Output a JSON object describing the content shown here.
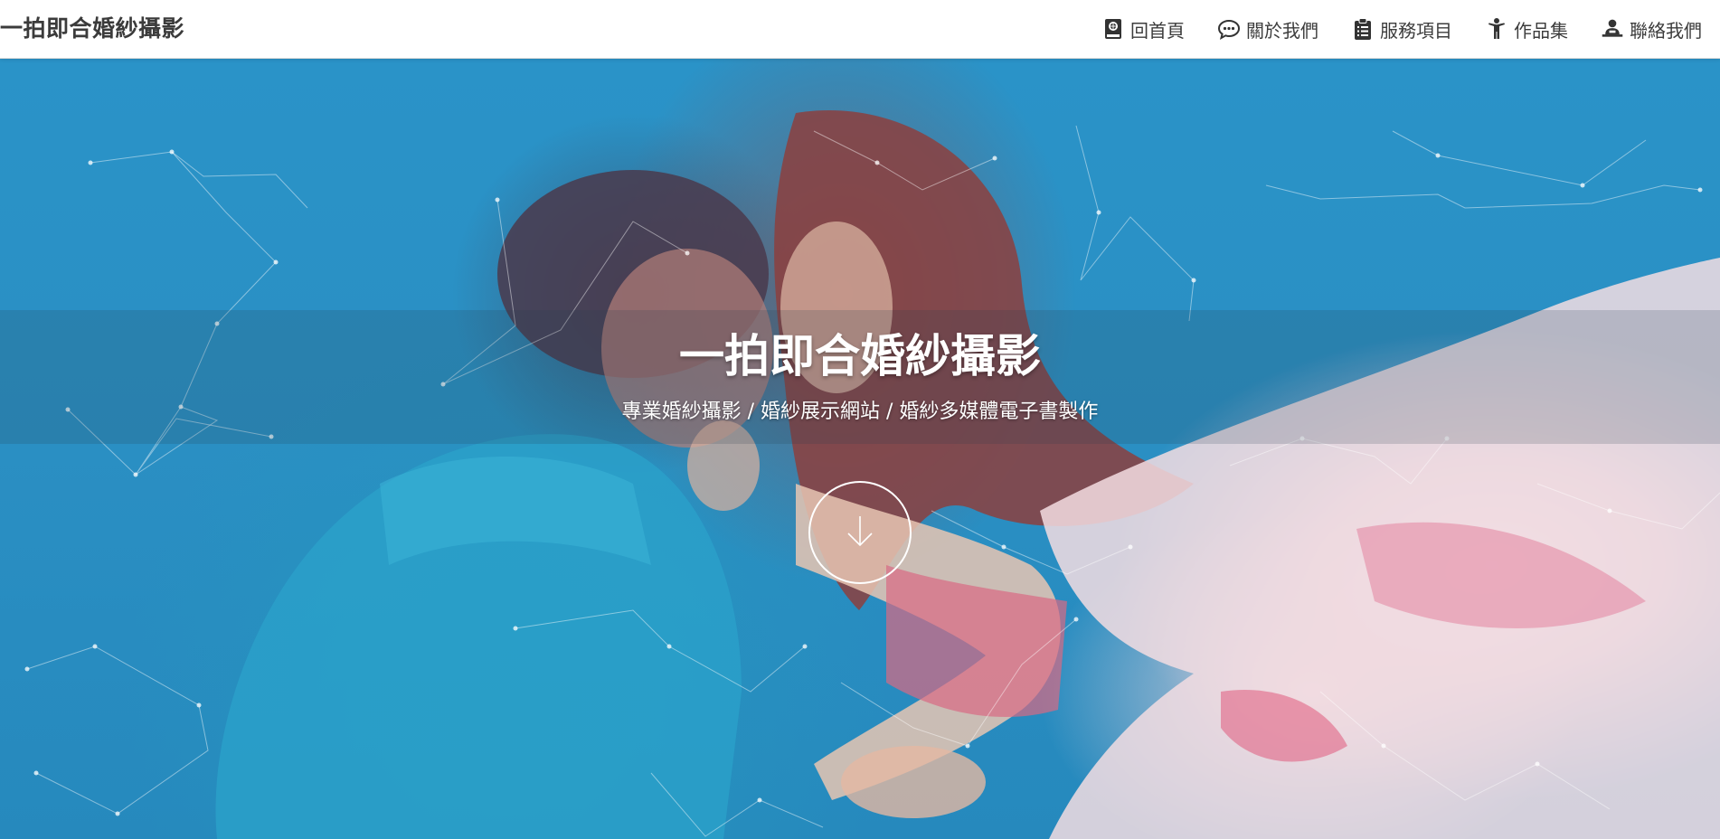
{
  "brand": "一拍即合婚紗攝影",
  "nav": {
    "items": [
      {
        "label": "回首頁",
        "icon": "home-book-icon"
      },
      {
        "label": "關於我們",
        "icon": "chat-bubble-icon"
      },
      {
        "label": "服務項目",
        "icon": "clipboard-icon"
      },
      {
        "label": "作品集",
        "icon": "person-icon"
      },
      {
        "label": "聯絡我們",
        "icon": "contact-person-icon"
      }
    ]
  },
  "hero": {
    "title": "一拍即合婚紗攝影",
    "subtitle": "專業婚紗攝影 / 婚紗展示網站 / 婚紗多媒體電子書製作",
    "scroll_icon": "arrow-down-icon"
  },
  "colors": {
    "nav_text": "#3c3c3c",
    "hero_water": "#2a93c8",
    "hero_text": "#ffffff"
  }
}
